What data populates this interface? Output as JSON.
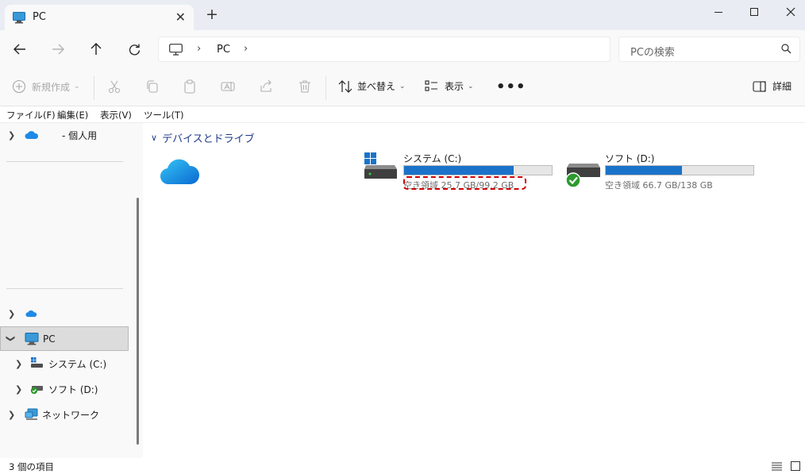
{
  "window": {
    "tab_title": "PC",
    "new_tab_label": "+",
    "tab_close_label": "✕"
  },
  "address": {
    "crumb": "PC",
    "separator": "›"
  },
  "search": {
    "placeholder": "PCの検索"
  },
  "commands": {
    "new_label": "新規作成",
    "sort_label": "並べ替え",
    "view_label": "表示",
    "more_label": "•••",
    "details_label": "詳細"
  },
  "menu": [
    "ファイル(F)",
    "編集(E)",
    "表示(V)",
    "ツール(T)"
  ],
  "sidebar": {
    "onedrive_label": "- 個人用",
    "pc_label": "PC",
    "drive_c_label": "システム (C:)",
    "drive_d_label": "ソフト (D:)",
    "network_label": "ネットワーク"
  },
  "content": {
    "group_title": "デバイスとドライブ",
    "drives": [
      {
        "name": "システム (C:)",
        "free_text": "空き領域 25.7 GB/99.2 GB",
        "used_fraction": 0.741
      },
      {
        "name": "ソフト (D:)",
        "free_text": "空き領域 66.7 GB/138 GB",
        "used_fraction": 0.517
      }
    ]
  },
  "status": {
    "item_count": "3 個の項目"
  },
  "colors": {
    "accent": "#1a73c9",
    "highlight": "#d10000",
    "titlebar": "#e9edf3"
  }
}
